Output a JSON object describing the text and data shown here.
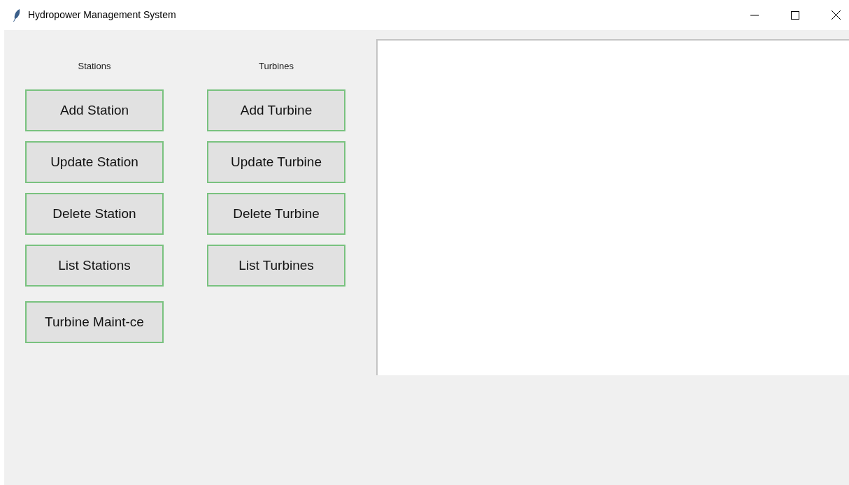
{
  "window": {
    "title": "Hydropower Management System"
  },
  "columns": [
    {
      "heading": "Stations",
      "buttons": [
        "Add Station",
        "Update Station",
        "Delete Station",
        "List Stations",
        "Turbine Maint-ce"
      ]
    },
    {
      "heading": "Turbines",
      "buttons": [
        "Add Turbine",
        "Update Turbine",
        "Delete Turbine",
        "List Turbines"
      ]
    }
  ]
}
